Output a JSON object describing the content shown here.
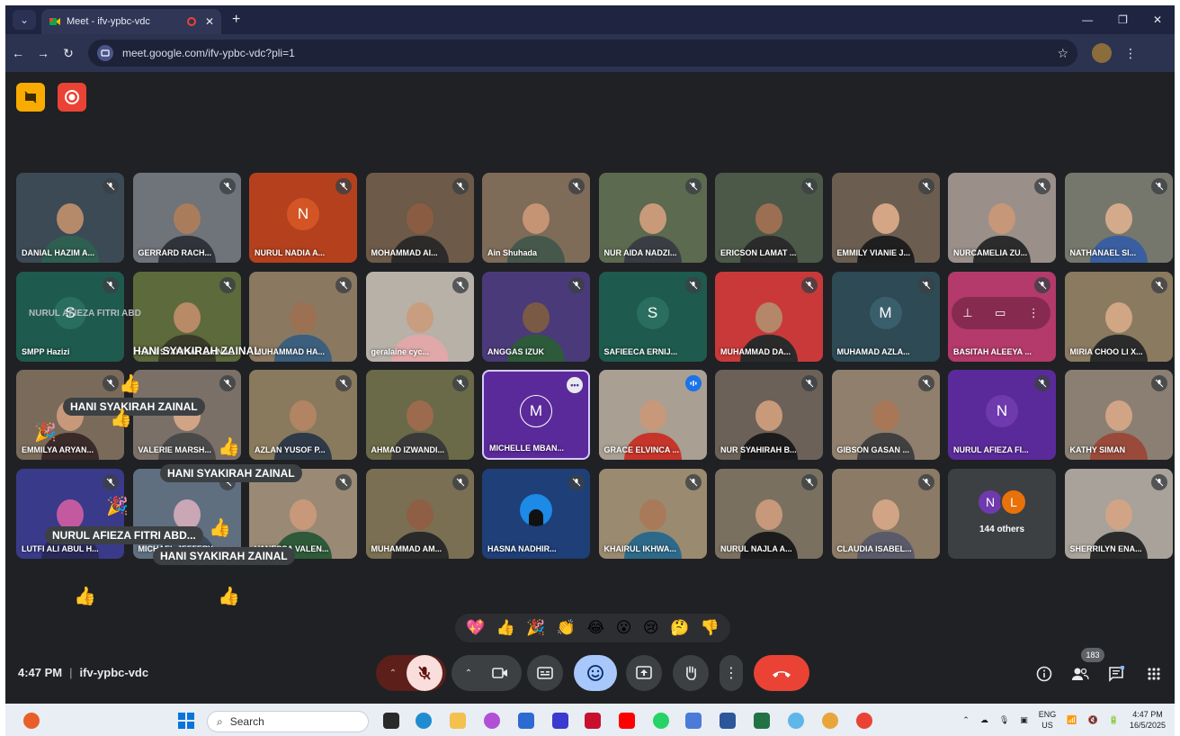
{
  "browser": {
    "tab_title": "Meet - ifv-ypbc-vdc",
    "url": "meet.google.com/ifv-ypbc-vdc?pli=1"
  },
  "participants": [
    {
      "name": "DANIAL HAZIM A...",
      "type": "video",
      "bg": "#3b4a55",
      "skin": "#b58a6a",
      "shirt": "#2f5f50"
    },
    {
      "name": "GERRARD RACH...",
      "type": "video",
      "bg": "#6f737a",
      "skin": "#a97d5c",
      "shirt": "#30343a"
    },
    {
      "name": "NURUL NADIA A...",
      "type": "avatar",
      "letter": "N",
      "bg": "#b5401e",
      "avatar_bg": "#d35525"
    },
    {
      "name": "MOHAMMAD AI...",
      "type": "video",
      "bg": "#6d5a48",
      "skin": "#8a5d43",
      "shirt": "#2d2a2a"
    },
    {
      "name": "Ain Shuhada",
      "type": "video",
      "bg": "#7e6b58",
      "skin": "#c49474",
      "shirt": "#46584b"
    },
    {
      "name": "NUR AIDA NADZI...",
      "type": "video",
      "bg": "#5c6a4f",
      "skin": "#c99a7a",
      "shirt": "#3a3e44"
    },
    {
      "name": "ERICSON LAMAT ...",
      "type": "video",
      "bg": "#4d5948",
      "skin": "#9c6f52",
      "shirt": "#2b2b2b"
    },
    {
      "name": "EMMILY VIANIE J...",
      "type": "video",
      "bg": "#6b5e51",
      "skin": "#d4a685",
      "shirt": "#1f1f1f"
    },
    {
      "name": "NURCAMELIA ZU...",
      "type": "video",
      "bg": "#9a9089",
      "skin": "#c79779",
      "shirt": "#2c2c2c"
    },
    {
      "name": "NATHANAEL SI...",
      "type": "video",
      "bg": "#76776c",
      "skin": "#d4ab8a",
      "shirt": "#3a5fa0"
    },
    {
      "name": "SMPP Hazizi",
      "type": "avatar",
      "letter": "S",
      "bg": "#1e5a4e",
      "avatar_bg": "#2a6e5f"
    },
    {
      "name": "HANI SYAKIRAH ZAINAL",
      "type": "video",
      "bg": "#5d6a3b",
      "skin": "#b88a65",
      "shirt": "#3a3a2a"
    },
    {
      "name": "MUHAMMAD HA...",
      "type": "video",
      "bg": "#8a7860",
      "skin": "#9c7052",
      "shirt": "#3b5f7d"
    },
    {
      "name": "geralaine cyc...",
      "type": "video",
      "bg": "#b7b1a8",
      "skin": "#c99d80",
      "shirt": "#e0a8a8"
    },
    {
      "name": "ANGGAS IZUK",
      "type": "video",
      "bg": "#4a3a7a",
      "skin": "#7a5a45",
      "shirt": "#2d5a3a"
    },
    {
      "name": "SAFIEECA ERNIJ...",
      "type": "avatar",
      "letter": "S",
      "bg": "#1e5a4e",
      "avatar_bg": "#2a6e5f"
    },
    {
      "name": "MUHAMMAD DA...",
      "type": "video",
      "bg": "#c9393a",
      "skin": "#b5876a",
      "shirt": "#2a2a2a"
    },
    {
      "name": "MUHAMAD AZLA...",
      "type": "avatar",
      "letter": "M",
      "bg": "#2d4a55",
      "avatar_bg": "#3a5f6c"
    },
    {
      "name": "BASITAH ALEEYA ...",
      "type": "video",
      "bg": "#b33a6a",
      "skin": "#b33a6a",
      "shirt": "#b33a6a"
    },
    {
      "name": "MIRIA CHOO LI X...",
      "type": "video",
      "bg": "#8a7a60",
      "skin": "#d0a685",
      "shirt": "#2b2b2b"
    },
    {
      "name": "EMMILYA ARYAN...",
      "type": "video",
      "bg": "#7a6a5a",
      "skin": "#c8987a",
      "shirt": "#3a2a2a"
    },
    {
      "name": "VALERIE MARSH...",
      "type": "video",
      "bg": "#7a7068",
      "skin": "#d0a484",
      "shirt": "#4a4a4a"
    },
    {
      "name": "AZLAN YUSOF P...",
      "type": "video",
      "bg": "#8a7a5d",
      "skin": "#b18464",
      "shirt": "#2e3a48"
    },
    {
      "name": "AHMAD IZWANDI...",
      "type": "video",
      "bg": "#6a6a48",
      "skin": "#9c6a4c",
      "shirt": "#3a3a3a"
    },
    {
      "name": "MICHELLE MBAN...",
      "type": "avatar",
      "letter": "M",
      "bg": "#5b2a9a",
      "avatar_bg": "#6e3aad"
    },
    {
      "name": "GRACE ELVINCA ...",
      "type": "video",
      "bg": "#a99f93",
      "skin": "#c8987a",
      "shirt": "#c7352a"
    },
    {
      "name": "NUR SYAHIRAH B...",
      "type": "video",
      "bg": "#6b6158",
      "skin": "#c89a7a",
      "shirt": "#1c1c1c"
    },
    {
      "name": "GIBSON GASAN ...",
      "type": "video",
      "bg": "#8f7f6c",
      "skin": "#a87758",
      "shirt": "#404040"
    },
    {
      "name": "NURUL AFIEZA FI...",
      "type": "avatar",
      "letter": "N",
      "bg": "#5b2a9a",
      "avatar_bg": "#6e3aad"
    },
    {
      "name": "KATHY SIMAN",
      "type": "video",
      "bg": "#8a7f72",
      "skin": "#d0a485",
      "shirt": "#9a4a3a"
    },
    {
      "name": "LUTFI ALI ABUL H...",
      "type": "video",
      "bg": "#3a3a8a",
      "skin": "#c35aa0",
      "shirt": "#2a2a5a"
    },
    {
      "name": "MICHAEL JEFFERY",
      "type": "video",
      "bg": "#5f6f80",
      "skin": "#c9a7b5",
      "shirt": "#3b4a5a"
    },
    {
      "name": "VANESSA VALEN...",
      "type": "video",
      "bg": "#9a8a75",
      "skin": "#c8987a",
      "shirt": "#2e5a3a"
    },
    {
      "name": "MUHAMMAD AM...",
      "type": "video",
      "bg": "#7a6f52",
      "skin": "#8e5f44",
      "shirt": "#2a2a2a"
    },
    {
      "name": "HASNA NADHIR...",
      "type": "avatar_img",
      "bg": "#1e3f78",
      "avatar_bg": "#1c8ae6"
    },
    {
      "name": "KHAIRUL IKHWA...",
      "type": "video",
      "bg": "#9a8a70",
      "skin": "#a97a5a",
      "shirt": "#2d6a8a"
    },
    {
      "name": "NURUL NAJLA A...",
      "type": "video",
      "bg": "#7a7060",
      "skin": "#c8987a",
      "shirt": "#1c1c1c"
    },
    {
      "name": "CLAUDIA ISABEL...",
      "type": "video",
      "bg": "#8a7a66",
      "skin": "#d0a485",
      "shirt": "#5a5a6a"
    },
    {
      "name": "144 others",
      "type": "others"
    },
    {
      "name": "SHERRILYN ENA...",
      "type": "video",
      "bg": "#a8a29a",
      "skin": "#d0a485",
      "shirt": "#2b2b2b"
    }
  ],
  "tile_overlay": {
    "letter": "N",
    "name": "NURUL AFIEZA FITRI ABD..."
  },
  "overlay_labels": {
    "smpp_ghost": "NURUL AFIEZA FITRI ABD",
    "hani1": "HANI SYAKIRAH ZAINAL",
    "hani2": "HANI SYAKIRAH ZAINAL",
    "hani3": "HANI SYAKIRAH ZAINAL",
    "nurul_overlay": "NURUL AFIEZA FITRI ABD..."
  },
  "reactions_bar": [
    "💖",
    "👍",
    "🎉",
    "👏",
    "😂",
    "😮",
    "😢",
    "🤔",
    "👎"
  ],
  "meeting": {
    "time": "4:47 PM",
    "code": "ifv-ypbc-vdc",
    "participant_count": "183"
  },
  "taskbar": {
    "search_placeholder": "Search",
    "lang_top": "ENG",
    "lang_bottom": "US",
    "clock_time": "4:47 PM",
    "clock_date": "16/5/2025"
  },
  "colors": {
    "meet_bg": "#202124",
    "end_call": "#ea4335",
    "mic_off_bg": "#f9dedc",
    "reaction_active": "#a8c7fa"
  }
}
